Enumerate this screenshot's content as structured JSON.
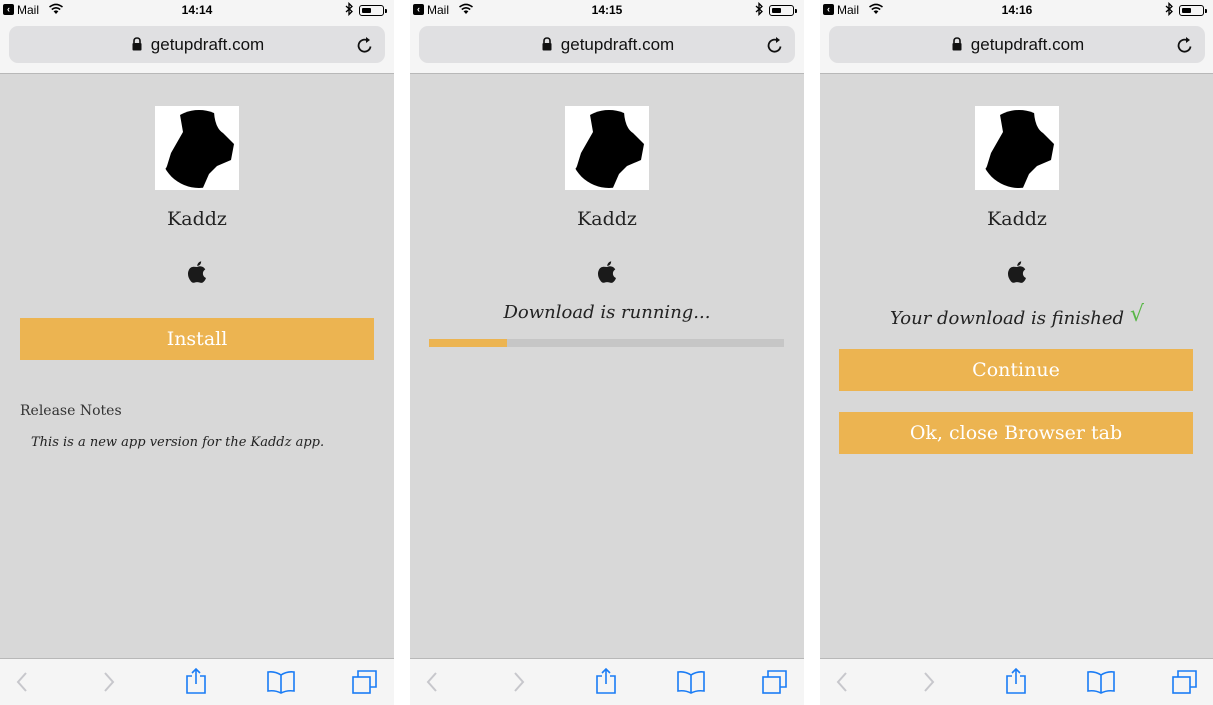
{
  "screens": [
    {
      "status_bar": {
        "back_app": "Mail",
        "time": "14:14"
      },
      "address_bar": {
        "url": "getupdraft.com"
      },
      "app": {
        "name": "Kaddz"
      },
      "install_label": "Install",
      "release_notes": {
        "title": "Release Notes",
        "text": "This is a new app version for the Kaddz app."
      }
    },
    {
      "status_bar": {
        "back_app": "Mail",
        "time": "14:15"
      },
      "address_bar": {
        "url": "getupdraft.com"
      },
      "app": {
        "name": "Kaddz"
      },
      "download": {
        "status": "Download is running...",
        "progress_fraction": 0.22
      }
    },
    {
      "status_bar": {
        "back_app": "Mail",
        "time": "14:16"
      },
      "address_bar": {
        "url": "getupdraft.com"
      },
      "app": {
        "name": "Kaddz"
      },
      "finished_text": "Your download is finished",
      "check_mark": "√",
      "continue_label": "Continue",
      "close_tab_label": "Ok, close Browser tab"
    }
  ],
  "colors": {
    "accent": "#ecb451",
    "page_background": "#d8d8d8",
    "success": "#59b748",
    "toolbar_icon_active": "#1a7cf5",
    "toolbar_icon_disabled": "#c7c7cc"
  },
  "icons": {
    "status_bar": [
      "back-arrow-icon",
      "wifi-icon",
      "bluetooth-icon",
      "battery-icon"
    ],
    "address_bar": [
      "lock-icon",
      "reload-icon"
    ],
    "content": [
      "app-logo-icon",
      "apple-icon",
      "check-icon"
    ],
    "toolbar": [
      "back-icon",
      "forward-icon",
      "share-icon",
      "bookmarks-icon",
      "tabs-icon"
    ]
  }
}
